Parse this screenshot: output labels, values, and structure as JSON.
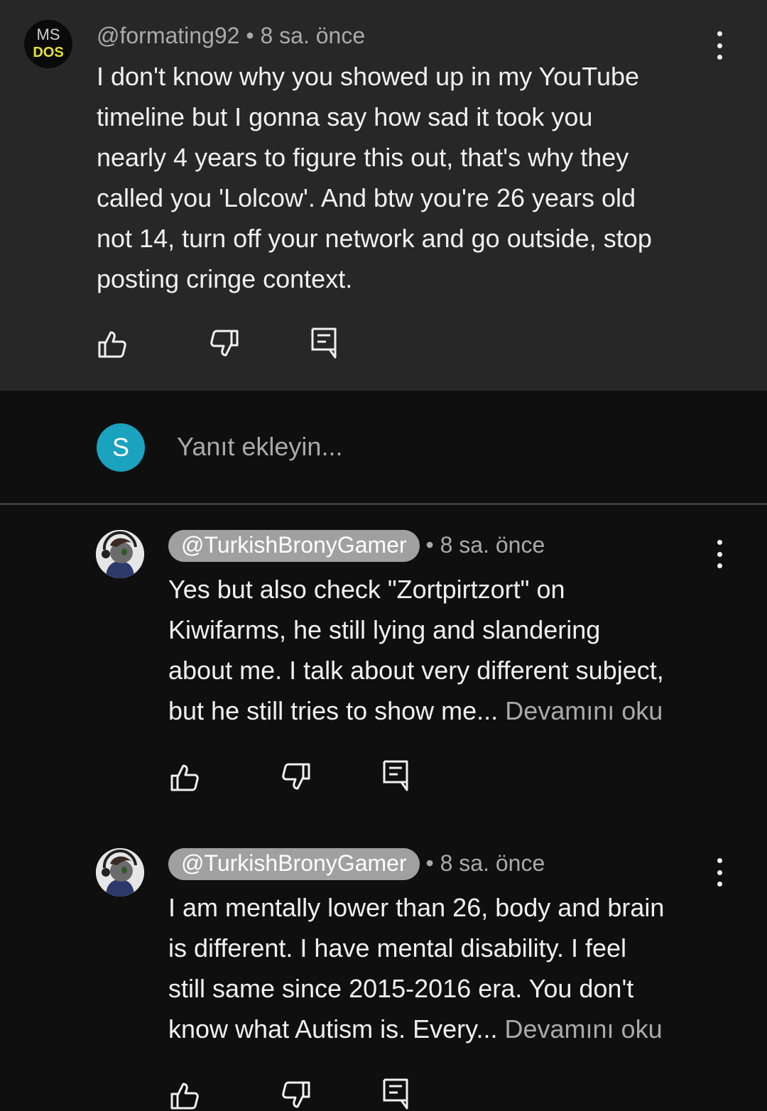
{
  "parent_comment": {
    "handle": "@formating92",
    "time": "8 sa. önce",
    "avatar_text_top": "MS",
    "avatar_text_bottom": "DOS",
    "lines": [
      "I don't know why you showed up in my YouTube",
      "timeline but I gonna say how sad it took you",
      "nearly 4 years to figure this out, that's why they",
      "called you 'Lolcow'. And btw you're 26 years old",
      "not 14, turn off your network and go outside, stop",
      "posting cringe context."
    ]
  },
  "reply_input": {
    "avatar_letter": "S",
    "placeholder": "Yanıt ekleyin..."
  },
  "replies": [
    {
      "handle": "@TurkishBronyGamer",
      "time": "8 sa. önce",
      "lines": [
        "Yes but also check \"Zortpirtzort\" on",
        "Kiwifarms, he still lying and slandering",
        "about me. I talk about very different subject,",
        "but he still tries to show me..."
      ],
      "more": "Devamını oku"
    },
    {
      "handle": "@TurkishBronyGamer",
      "time": "8 sa. önce",
      "lines": [
        "I am mentally lower than 26, body and brain",
        "is different. I have mental disability. I feel",
        "still same since 2015-2016 era. You don't",
        "know what Autism is. Every..."
      ],
      "more": "Devamını oku"
    }
  ],
  "separator": "•",
  "colors": {
    "parent_bg": "#272727",
    "page_bg": "#0f0f0f",
    "reply_avatar": "#1ba2bf",
    "handle_chip": "#a0a0a0"
  },
  "icons": [
    "like-icon",
    "dislike-icon",
    "reply-icon",
    "more-vert-icon"
  ]
}
